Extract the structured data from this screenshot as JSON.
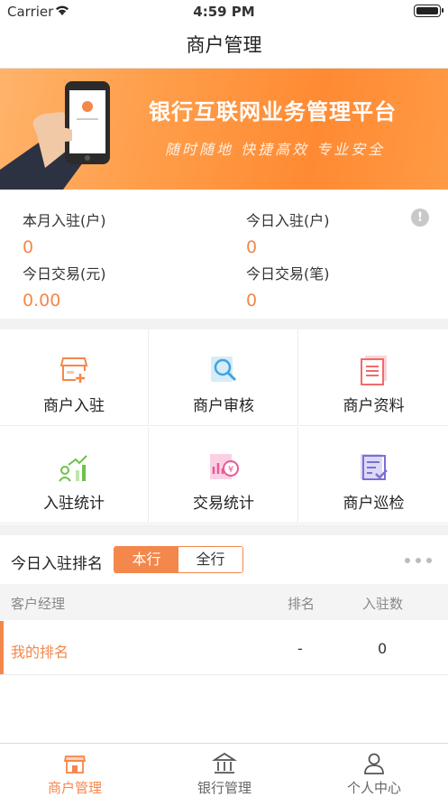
{
  "status_bar": {
    "carrier": "Carrier",
    "time": "4:59 PM"
  },
  "nav": {
    "title": "商户管理"
  },
  "banner": {
    "title": "银行互联网业务管理平台",
    "slogan": "随时随地 快捷高效 专业安全"
  },
  "stats": [
    {
      "label": "本月入驻(户)",
      "value": "0"
    },
    {
      "label": "今日入驻(户)",
      "value": "0"
    },
    {
      "label": "今日交易(元)",
      "value": "0.00"
    },
    {
      "label": "今日交易(笔)",
      "value": "0"
    }
  ],
  "grid": [
    {
      "label": "商户入驻",
      "icon": "store-add-icon",
      "color": "#f4874b"
    },
    {
      "label": "商户审核",
      "icon": "search-doc-icon",
      "color": "#3fa4e0"
    },
    {
      "label": "商户资料",
      "icon": "documents-icon",
      "color": "#f06b6b"
    },
    {
      "label": "入驻统计",
      "icon": "growth-chart-icon",
      "color": "#6cc24a"
    },
    {
      "label": "交易统计",
      "icon": "trade-chart-icon",
      "color": "#e8589a"
    },
    {
      "label": "商户巡检",
      "icon": "checklist-icon",
      "color": "#7a6fd6"
    }
  ],
  "ranking": {
    "title": "今日入驻排名",
    "tabs": [
      {
        "label": "本行",
        "active": true
      },
      {
        "label": "全行",
        "active": false
      }
    ],
    "columns": [
      "客户经理",
      "排名",
      "入驻数"
    ],
    "rows": [
      {
        "name": "我的排名",
        "rank": "-",
        "count": "0"
      }
    ]
  },
  "tabbar": [
    {
      "label": "商户管理",
      "icon": "store-icon",
      "active": true
    },
    {
      "label": "银行管理",
      "icon": "bank-icon",
      "active": false
    },
    {
      "label": "个人中心",
      "icon": "user-icon",
      "active": false
    }
  ],
  "colors": {
    "accent": "#f4874b",
    "inactive_tab": "#666666"
  }
}
